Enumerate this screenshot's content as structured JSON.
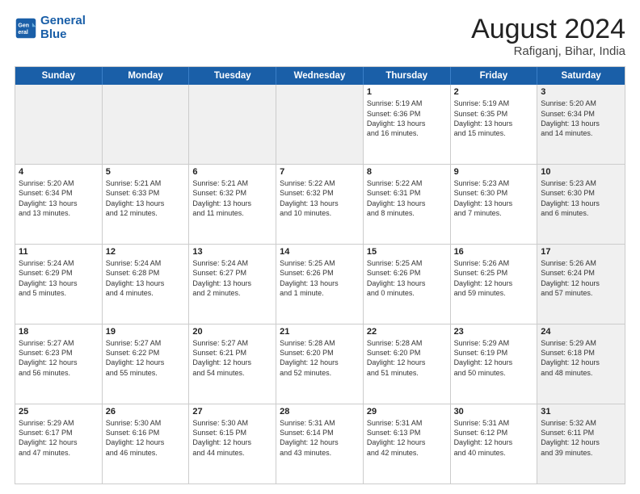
{
  "logo": {
    "line1": "General",
    "line2": "Blue"
  },
  "title": "August 2024",
  "subtitle": "Rafiganj, Bihar, India",
  "header_days": [
    "Sunday",
    "Monday",
    "Tuesday",
    "Wednesday",
    "Thursday",
    "Friday",
    "Saturday"
  ],
  "weeks": [
    [
      {
        "day": "",
        "text": "",
        "shaded": true
      },
      {
        "day": "",
        "text": "",
        "shaded": true
      },
      {
        "day": "",
        "text": "",
        "shaded": true
      },
      {
        "day": "",
        "text": "",
        "shaded": true
      },
      {
        "day": "1",
        "text": "Sunrise: 5:19 AM\nSunset: 6:36 PM\nDaylight: 13 hours\nand 16 minutes."
      },
      {
        "day": "2",
        "text": "Sunrise: 5:19 AM\nSunset: 6:35 PM\nDaylight: 13 hours\nand 15 minutes."
      },
      {
        "day": "3",
        "text": "Sunrise: 5:20 AM\nSunset: 6:34 PM\nDaylight: 13 hours\nand 14 minutes.",
        "shaded": true
      }
    ],
    [
      {
        "day": "4",
        "text": "Sunrise: 5:20 AM\nSunset: 6:34 PM\nDaylight: 13 hours\nand 13 minutes."
      },
      {
        "day": "5",
        "text": "Sunrise: 5:21 AM\nSunset: 6:33 PM\nDaylight: 13 hours\nand 12 minutes."
      },
      {
        "day": "6",
        "text": "Sunrise: 5:21 AM\nSunset: 6:32 PM\nDaylight: 13 hours\nand 11 minutes."
      },
      {
        "day": "7",
        "text": "Sunrise: 5:22 AM\nSunset: 6:32 PM\nDaylight: 13 hours\nand 10 minutes."
      },
      {
        "day": "8",
        "text": "Sunrise: 5:22 AM\nSunset: 6:31 PM\nDaylight: 13 hours\nand 8 minutes."
      },
      {
        "day": "9",
        "text": "Sunrise: 5:23 AM\nSunset: 6:30 PM\nDaylight: 13 hours\nand 7 minutes."
      },
      {
        "day": "10",
        "text": "Sunrise: 5:23 AM\nSunset: 6:30 PM\nDaylight: 13 hours\nand 6 minutes.",
        "shaded": true
      }
    ],
    [
      {
        "day": "11",
        "text": "Sunrise: 5:24 AM\nSunset: 6:29 PM\nDaylight: 13 hours\nand 5 minutes."
      },
      {
        "day": "12",
        "text": "Sunrise: 5:24 AM\nSunset: 6:28 PM\nDaylight: 13 hours\nand 4 minutes."
      },
      {
        "day": "13",
        "text": "Sunrise: 5:24 AM\nSunset: 6:27 PM\nDaylight: 13 hours\nand 2 minutes."
      },
      {
        "day": "14",
        "text": "Sunrise: 5:25 AM\nSunset: 6:26 PM\nDaylight: 13 hours\nand 1 minute."
      },
      {
        "day": "15",
        "text": "Sunrise: 5:25 AM\nSunset: 6:26 PM\nDaylight: 13 hours\nand 0 minutes."
      },
      {
        "day": "16",
        "text": "Sunrise: 5:26 AM\nSunset: 6:25 PM\nDaylight: 12 hours\nand 59 minutes."
      },
      {
        "day": "17",
        "text": "Sunrise: 5:26 AM\nSunset: 6:24 PM\nDaylight: 12 hours\nand 57 minutes.",
        "shaded": true
      }
    ],
    [
      {
        "day": "18",
        "text": "Sunrise: 5:27 AM\nSunset: 6:23 PM\nDaylight: 12 hours\nand 56 minutes."
      },
      {
        "day": "19",
        "text": "Sunrise: 5:27 AM\nSunset: 6:22 PM\nDaylight: 12 hours\nand 55 minutes."
      },
      {
        "day": "20",
        "text": "Sunrise: 5:27 AM\nSunset: 6:21 PM\nDaylight: 12 hours\nand 54 minutes."
      },
      {
        "day": "21",
        "text": "Sunrise: 5:28 AM\nSunset: 6:20 PM\nDaylight: 12 hours\nand 52 minutes."
      },
      {
        "day": "22",
        "text": "Sunrise: 5:28 AM\nSunset: 6:20 PM\nDaylight: 12 hours\nand 51 minutes."
      },
      {
        "day": "23",
        "text": "Sunrise: 5:29 AM\nSunset: 6:19 PM\nDaylight: 12 hours\nand 50 minutes."
      },
      {
        "day": "24",
        "text": "Sunrise: 5:29 AM\nSunset: 6:18 PM\nDaylight: 12 hours\nand 48 minutes.",
        "shaded": true
      }
    ],
    [
      {
        "day": "25",
        "text": "Sunrise: 5:29 AM\nSunset: 6:17 PM\nDaylight: 12 hours\nand 47 minutes."
      },
      {
        "day": "26",
        "text": "Sunrise: 5:30 AM\nSunset: 6:16 PM\nDaylight: 12 hours\nand 46 minutes."
      },
      {
        "day": "27",
        "text": "Sunrise: 5:30 AM\nSunset: 6:15 PM\nDaylight: 12 hours\nand 44 minutes."
      },
      {
        "day": "28",
        "text": "Sunrise: 5:31 AM\nSunset: 6:14 PM\nDaylight: 12 hours\nand 43 minutes."
      },
      {
        "day": "29",
        "text": "Sunrise: 5:31 AM\nSunset: 6:13 PM\nDaylight: 12 hours\nand 42 minutes."
      },
      {
        "day": "30",
        "text": "Sunrise: 5:31 AM\nSunset: 6:12 PM\nDaylight: 12 hours\nand 40 minutes."
      },
      {
        "day": "31",
        "text": "Sunrise: 5:32 AM\nSunset: 6:11 PM\nDaylight: 12 hours\nand 39 minutes.",
        "shaded": true
      }
    ]
  ]
}
